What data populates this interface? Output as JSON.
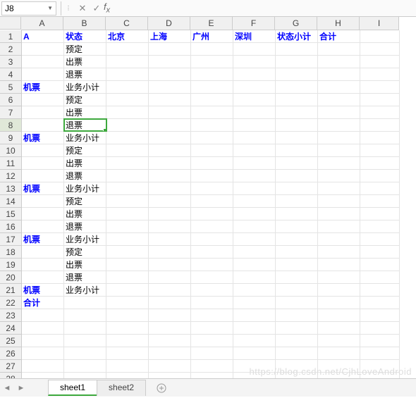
{
  "nameBox": "J8",
  "formula": "",
  "columnLabels": [
    "A",
    "B",
    "C",
    "D",
    "E",
    "F",
    "G",
    "H",
    "I"
  ],
  "rowCount": 28,
  "selectedCell": {
    "row": 8,
    "col": "B"
  },
  "headerRow": {
    "A": "A",
    "B": "状态",
    "C": "北京",
    "D": "上海",
    "E": "广州",
    "F": "深圳",
    "G": "状态小计",
    "H": "合计"
  },
  "groups": [
    {
      "label": "机票",
      "rows": [
        "预定",
        "出票",
        "退票",
        "业务小计"
      ]
    },
    {
      "label": "机票",
      "rows": [
        "预定",
        "出票",
        "退票",
        "业务小计"
      ]
    },
    {
      "label": "机票",
      "rows": [
        "预定",
        "出票",
        "退票",
        "业务小计"
      ]
    },
    {
      "label": "机票",
      "rows": [
        "预定",
        "出票",
        "退票",
        "业务小计"
      ]
    },
    {
      "label": "机票",
      "rows": [
        "预定",
        "出票",
        "退票",
        "业务小计"
      ]
    }
  ],
  "totalLabel": "合计",
  "tabs": [
    {
      "name": "sheet1",
      "active": true
    },
    {
      "name": "sheet2",
      "active": false
    }
  ],
  "watermark": "https://blog.csdn.net/CjhLoveAndroid"
}
